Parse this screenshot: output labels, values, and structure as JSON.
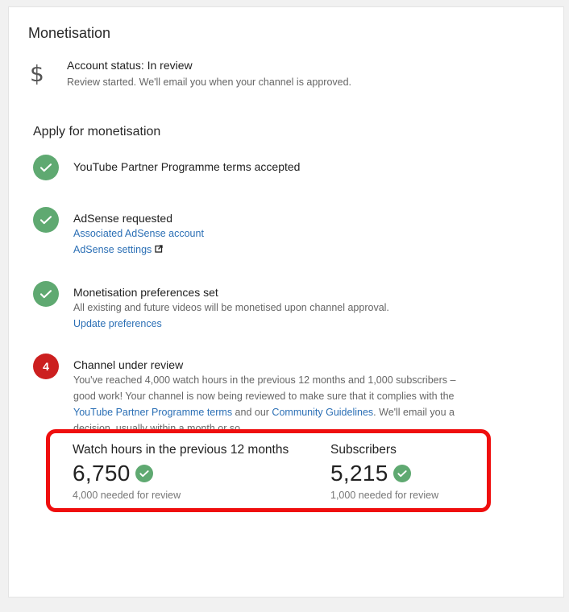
{
  "colors": {
    "success": "#5fa971",
    "alert": "#cc1f1f",
    "link": "#2b6fb5",
    "highlight": "#ef0e0e"
  },
  "header": {
    "title": "Monetisation"
  },
  "account": {
    "icon": "dollar-icon",
    "status": "Account status: In review",
    "subtext": "Review started. We'll email you when your channel is approved."
  },
  "apply": {
    "title": "Apply for monetisation",
    "steps": [
      {
        "state": "done",
        "title": "YouTube Partner Programme terms accepted"
      },
      {
        "state": "done",
        "title": "AdSense requested",
        "link1": "Associated AdSense account",
        "link2": "AdSense settings"
      },
      {
        "state": "done",
        "title": "Monetisation preferences set",
        "text": "All existing and future videos will be monetised upon channel approval.",
        "link1": "Update preferences"
      },
      {
        "state": "current",
        "number": "4",
        "title": "Channel under review",
        "text_a": "You've reached 4,000 watch hours in the previous 12 months and 1,000 subscribers – good work! Your channel is now being reviewed to make sure that it complies with the ",
        "link_terms": "YouTube Partner Programme terms",
        "text_b": " and our ",
        "link_guidelines": "Community Guidelines",
        "text_c": ". We'll email you a decision, usually within a month or so."
      }
    ]
  },
  "stats": {
    "watch_hours": {
      "label": "Watch hours in the previous 12 months",
      "value": "6,750",
      "note": "4,000 needed for review"
    },
    "subscribers": {
      "label": "Subscribers",
      "value": "5,215",
      "note": "1,000 needed for review"
    }
  }
}
